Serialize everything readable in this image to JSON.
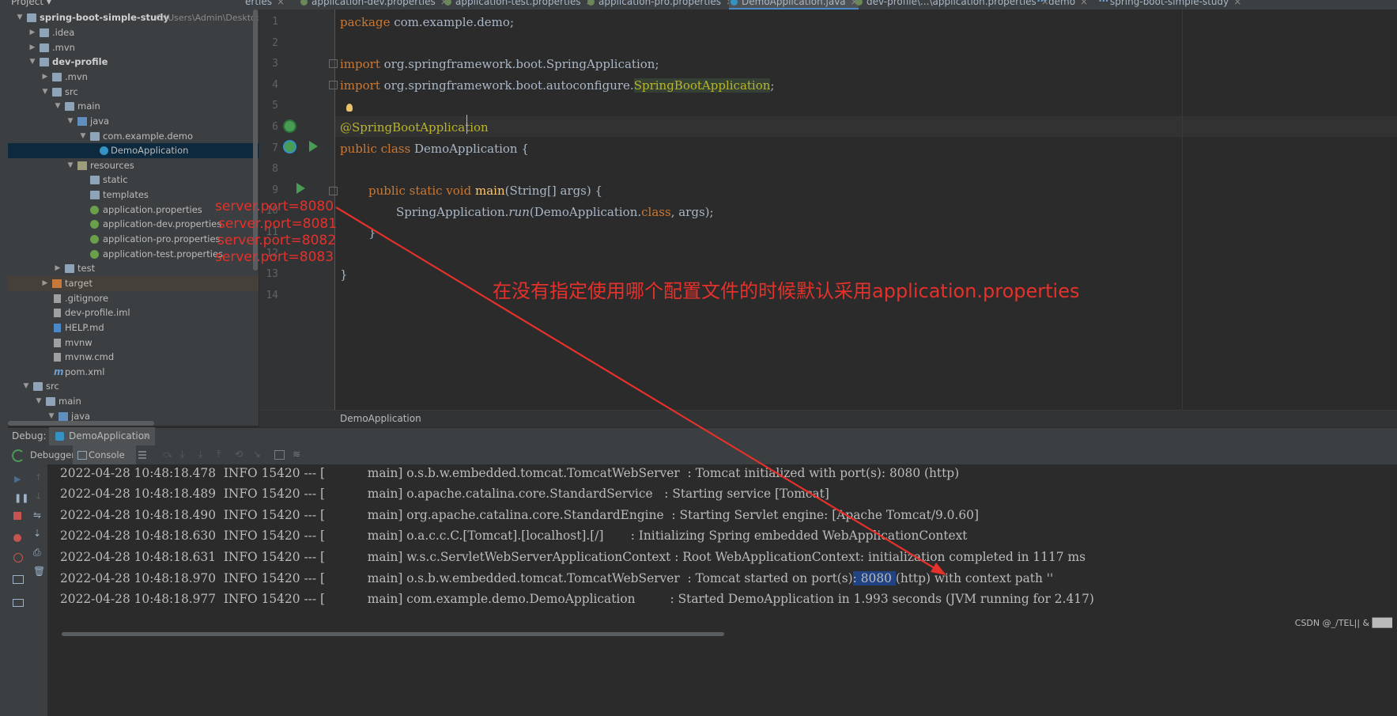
{
  "tabs": [
    {
      "label": "application.properties",
      "visible": "erties"
    },
    {
      "label": "application-dev.properties"
    },
    {
      "label": "application-test.properties"
    },
    {
      "label": "application-pro.properties"
    },
    {
      "label": "DemoApplication.java",
      "active": true
    },
    {
      "label": "dev-profile\\...\\application.properties"
    },
    {
      "label": "demo"
    },
    {
      "label": "spring-boot-simple-study"
    }
  ],
  "project": {
    "header": "Project",
    "root_name": "spring-boot-simple-study",
    "root_path": "C:\\Users\\Admin\\Desktop\\E",
    "items": [
      {
        "label": ".idea"
      },
      {
        "label": ".mvn"
      },
      {
        "label": "dev-profile"
      },
      {
        "label": ".mvn"
      },
      {
        "label": "src"
      },
      {
        "label": "main"
      },
      {
        "label": "java"
      },
      {
        "label": "com.example.demo"
      },
      {
        "label": "DemoApplication"
      },
      {
        "label": "resources"
      },
      {
        "label": "static"
      },
      {
        "label": "templates"
      },
      {
        "label": "application.properties"
      },
      {
        "label": "application-dev.properties"
      },
      {
        "label": "application-pro.properties"
      },
      {
        "label": "application-test.properties"
      },
      {
        "label": "test"
      },
      {
        "label": "target"
      },
      {
        "label": ".gitignore"
      },
      {
        "label": "dev-profile.iml"
      },
      {
        "label": "HELP.md"
      },
      {
        "label": "mvnw"
      },
      {
        "label": "mvnw.cmd"
      },
      {
        "label": "pom.xml"
      },
      {
        "label": "src"
      },
      {
        "label": "main"
      },
      {
        "label": "java"
      }
    ]
  },
  "editor": {
    "line_numbers": [
      "1",
      "2",
      "3",
      "4",
      "5",
      "6",
      "7",
      "8",
      "9",
      "10",
      "11",
      "12",
      "13",
      "14"
    ],
    "l1_kw": "package",
    "l1_rest": " com.example.demo;",
    "l3_kw": "import",
    "l3_rest": " org.springframework.boot.SpringApplication;",
    "l4_kw": "import",
    "l4_mid": " org.springframework.boot.autoconfigure.",
    "l4_hl": "SpringBootApplication",
    "l4_end": ";",
    "l6_ann": "@SpringBootApplication",
    "l7_kw": "public class",
    "l7_rest": " DemoApplication {",
    "l9_kw": "public static void",
    "l9_fn": "main",
    "l9_rest": "(String[] args) {",
    "l10_a": "SpringApplication.",
    "l10_it": "run",
    "l10_b": "(DemoApplication.",
    "l10_kw": "class",
    "l10_c": ", args);",
    "l11": "}",
    "l13": "}",
    "breadcrumb": "DemoApplication"
  },
  "debug": {
    "label": "Debug:",
    "tab": "DemoApplication",
    "debugger_tab": "Debugger",
    "console_tab": "Console",
    "console_lines": [
      {
        "ts": "2022-04-28 10:48:18.478",
        "level": "INFO",
        "pid": "15420",
        "thread": "main]",
        "logger": "o.s.b.w.embedded.tomcat.TomcatWebServer",
        "msg": ": Tomcat initialized with port(s): 8080 (http)"
      },
      {
        "ts": "2022-04-28 10:48:18.489",
        "level": "INFO",
        "pid": "15420",
        "thread": "main]",
        "logger": "o.apache.catalina.core.StandardService",
        "msg": ": Starting service [Tomcat]"
      },
      {
        "ts": "2022-04-28 10:48:18.490",
        "level": "INFO",
        "pid": "15420",
        "thread": "main]",
        "logger": "org.apache.catalina.core.StandardEngine",
        "msg": ": Starting Servlet engine: [Apache Tomcat/9.0.60]"
      },
      {
        "ts": "2022-04-28 10:48:18.630",
        "level": "INFO",
        "pid": "15420",
        "thread": "main]",
        "logger": "o.a.c.c.C.[Tomcat].[localhost].[/]",
        "msg": ": Initializing Spring embedded WebApplicationContext"
      },
      {
        "ts": "2022-04-28 10:48:18.631",
        "level": "INFO",
        "pid": "15420",
        "thread": "main]",
        "logger": "w.s.c.ServletWebServerApplicationContext",
        "msg": ": Root WebApplicationContext: initialization completed in 1117 ms"
      },
      {
        "ts": "2022-04-28 10:48:18.970",
        "level": "INFO",
        "pid": "15420",
        "thread": "main]",
        "logger": "o.s.b.w.embedded.tomcat.TomcatWebServer",
        "msg_a": ": Tomcat started on port(s)",
        "msg_hl": ": 8080 ",
        "msg_b": "(http) with context path ''"
      },
      {
        "ts": "2022-04-28 10:48:18.977",
        "level": "INFO",
        "pid": "15420",
        "thread": "main]",
        "logger": "com.example.demo.DemoApplication",
        "msg": ": Started DemoApplication in 1.993 seconds (JVM running for 2.417)"
      }
    ],
    "sep": "--- ["
  },
  "annotations": {
    "ports": [
      "server.port=8080",
      "server.port=8081",
      "server.port=8082",
      "server.port=8083"
    ],
    "note": "在没有指定使用哪个配置文件的时候默认采用application.properties",
    "color": "#e5312b"
  },
  "watermark": "CSDN @_/TEL|| & ███"
}
